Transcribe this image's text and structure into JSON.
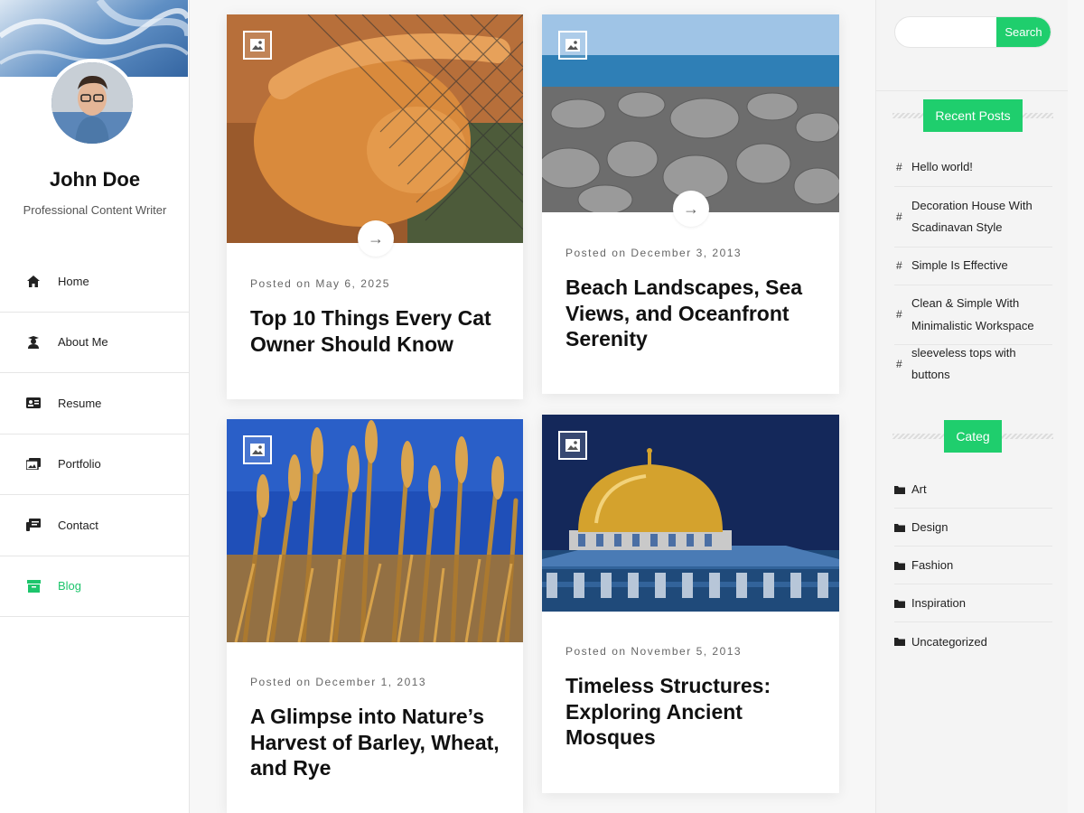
{
  "profile": {
    "name": "John Doe",
    "role": "Professional Content Writer"
  },
  "nav": [
    {
      "label": "Home",
      "icon": "home-icon"
    },
    {
      "label": "About Me",
      "icon": "user-graduate-icon"
    },
    {
      "label": "Resume",
      "icon": "id-card-icon"
    },
    {
      "label": "Portfolio",
      "icon": "images-icon"
    },
    {
      "label": "Contact",
      "icon": "contact-icon"
    },
    {
      "label": "Blog",
      "icon": "archive-icon",
      "active": true
    }
  ],
  "posts": [
    {
      "date": "Posted on May 6, 2025",
      "title": "Top 10 Things Every Cat Owner Should Know",
      "image": "orange cat on wire fence"
    },
    {
      "date": "Posted on December 3, 2013",
      "title": "Beach Landscapes, Sea Views, and Oceanfront Serenity",
      "image": "pebbles by the sea"
    },
    {
      "date": "Posted on December 1, 2013",
      "title": "A Glimpse into Nature’s Harvest of Barley, Wheat, and Rye",
      "image": "wheat field under blue sky"
    },
    {
      "date": "Posted on November 5, 2013",
      "title": "Timeless Structures: Exploring Ancient Mosques",
      "image": "golden dome mosque"
    }
  ],
  "search": {
    "placeholder": "",
    "button_label": "Search"
  },
  "recent_posts": {
    "heading": "Recent Posts",
    "items": [
      "Hello world!",
      "Decoration House With Scadinavan Style",
      "Simple Is Effective",
      "Clean & Simple With Minimalistic Workspace",
      "sleeveless tops with buttons"
    ]
  },
  "categories": {
    "heading": "Categ",
    "items": [
      "Art",
      "Design",
      "Fashion",
      "Inspiration",
      "Uncategorized"
    ]
  },
  "colors": {
    "accent": "#1fce6d",
    "text": "#111111"
  }
}
